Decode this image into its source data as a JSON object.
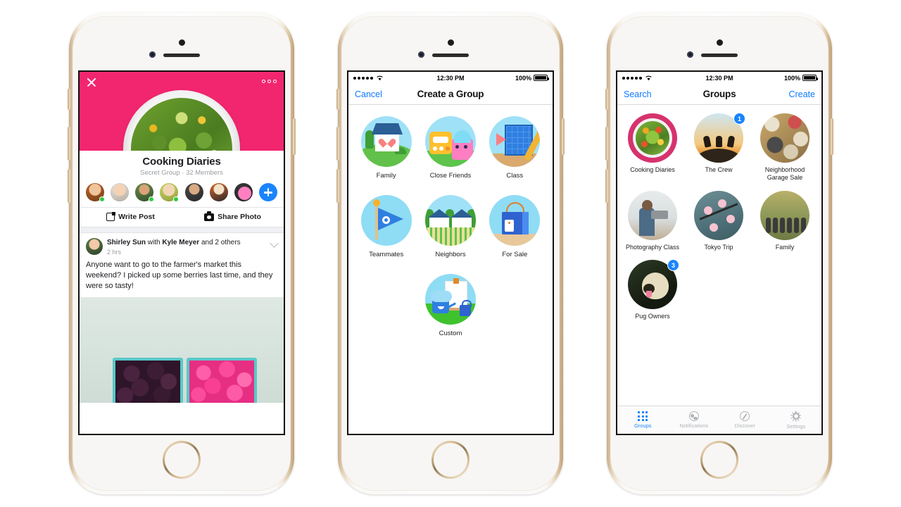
{
  "phones": [
    {
      "name": "group-detail-phone",
      "screen": {
        "header": {
          "close_icon": "close-icon",
          "more_icon": "more-options-icon",
          "cover_photo_alt": "salad-bowl-photo"
        },
        "group_title": "Cooking Diaries",
        "group_subtitle": "Secret Group · 32 Members",
        "members": [
          {
            "online": true
          },
          {
            "online": false
          },
          {
            "online": true
          },
          {
            "online": true
          },
          {
            "online": false
          },
          {
            "online": false
          },
          {
            "online": false
          }
        ],
        "add_member_label": "+",
        "actions": [
          {
            "label": "Write Post",
            "icon": "compose-icon"
          },
          {
            "label": "Share Photo",
            "icon": "camera-icon"
          }
        ],
        "post": {
          "author": "Shirley Sun",
          "with_text": "with",
          "tagged": "Kyle Meyer",
          "others": "and 2 others",
          "timestamp": "2 hrs",
          "body": "Anyone want to go to the farmer's market this weekend? I picked up some berries last time, and they were so tasty!",
          "photo_alt": "berries-in-crates-photo"
        }
      }
    },
    {
      "name": "create-group-phone",
      "screen": {
        "status_bar": {
          "signal": "•••••",
          "wifi": "wifi-icon",
          "time": "12:30 PM",
          "battery_pct": "100%"
        },
        "nav": {
          "left": "Cancel",
          "title": "Create a Group",
          "right": ""
        },
        "group_types": [
          {
            "label": "Family",
            "icon": "family-house-icon"
          },
          {
            "label": "Close Friends",
            "icon": "close-friends-robots-icon"
          },
          {
            "label": "Class",
            "icon": "class-chalkboard-icon"
          },
          {
            "label": "Teammates",
            "icon": "teammates-flag-icon"
          },
          {
            "label": "Neighbors",
            "icon": "neighbors-houses-icon"
          },
          {
            "label": "For Sale",
            "icon": "for-sale-bag-icon"
          },
          {
            "label": "Custom",
            "icon": "custom-easel-icon"
          }
        ]
      }
    },
    {
      "name": "groups-list-phone",
      "screen": {
        "status_bar": {
          "signal": "•••••",
          "wifi": "wifi-icon",
          "time": "12:30 PM",
          "battery_pct": "100%"
        },
        "nav": {
          "left": "Search",
          "title": "Groups",
          "right": "Create"
        },
        "groups": [
          {
            "label": "Cooking Diaries",
            "badge": "",
            "thumb": "salad-thumb"
          },
          {
            "label": "The Crew",
            "badge": "1",
            "thumb": "sunset-jump-thumb"
          },
          {
            "label": "Neighborhood Garage Sale",
            "badge": "",
            "thumb": "garage-sale-thumb"
          },
          {
            "label": "Photography Class",
            "badge": "",
            "thumb": "photographer-thumb"
          },
          {
            "label": "Tokyo Trip",
            "badge": "",
            "thumb": "cherry-blossom-thumb"
          },
          {
            "label": "Family",
            "badge": "",
            "thumb": "family-group-thumb"
          },
          {
            "label": "Pug Owners",
            "badge": "3",
            "thumb": "pug-thumb"
          }
        ],
        "tabs": [
          {
            "label": "Groups",
            "icon": "grid-icon",
            "active": true
          },
          {
            "label": "Notifications",
            "icon": "globe-icon",
            "active": false
          },
          {
            "label": "Discover",
            "icon": "compass-icon",
            "active": false
          },
          {
            "label": "Settings",
            "icon": "gear-icon",
            "active": false
          }
        ]
      }
    }
  ],
  "colors": {
    "accent_blue": "#1a84fc",
    "link_blue": "#0e7afe",
    "hero_pink": "#f2266f",
    "online_green": "#2ecc3f",
    "text_primary": "#1c1e21",
    "text_muted": "#9a9da1"
  }
}
